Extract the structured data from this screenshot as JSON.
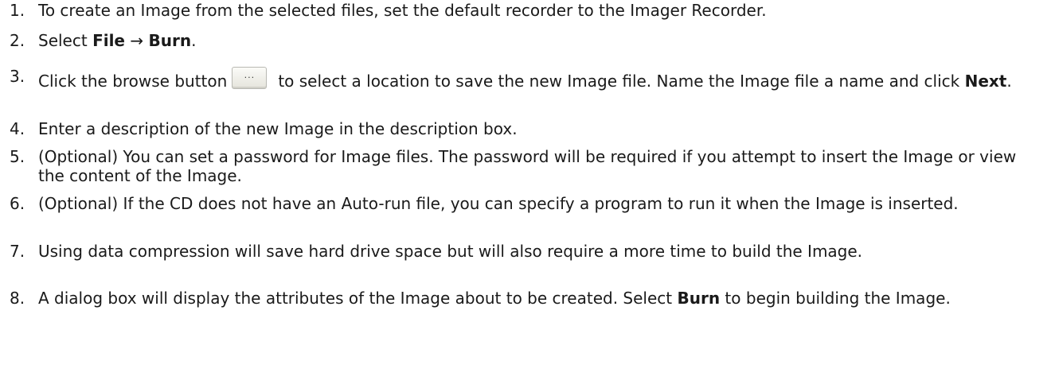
{
  "steps": [
    {
      "number": "1.",
      "text": "To create an Image from the selected files, set the default recorder to the Imager Recorder."
    },
    {
      "number": "2.",
      "prefix": "Select ",
      "bold1": "File",
      "arrow": " → ",
      "bold2": "Burn",
      "suffix": "."
    },
    {
      "number": "3.",
      "prefix": "Click the browse button",
      "button_label": "...",
      "middle": "to select a location to save the new Image file. Name the Image file a name and click ",
      "bold": "Next",
      "suffix": "."
    },
    {
      "number": "4.",
      "text": "Enter a description of the new Image in the description box."
    },
    {
      "number": "5.",
      "text": "(Optional) You can set a password for Image files. The password will be required if you attempt to insert the Image or view the content of the Image."
    },
    {
      "number": "6.",
      "text": "(Optional) If the CD does not have an Auto-run file, you can specify a program to run it when the Image is inserted."
    },
    {
      "number": "7.",
      "text": "Using data compression will save hard drive space but will also require a more time to build the Image."
    },
    {
      "number": "8.",
      "prefix": "A dialog box will display the attributes of the Image about to be created. Select ",
      "bold": "Burn",
      "suffix": " to begin building the Image."
    }
  ]
}
